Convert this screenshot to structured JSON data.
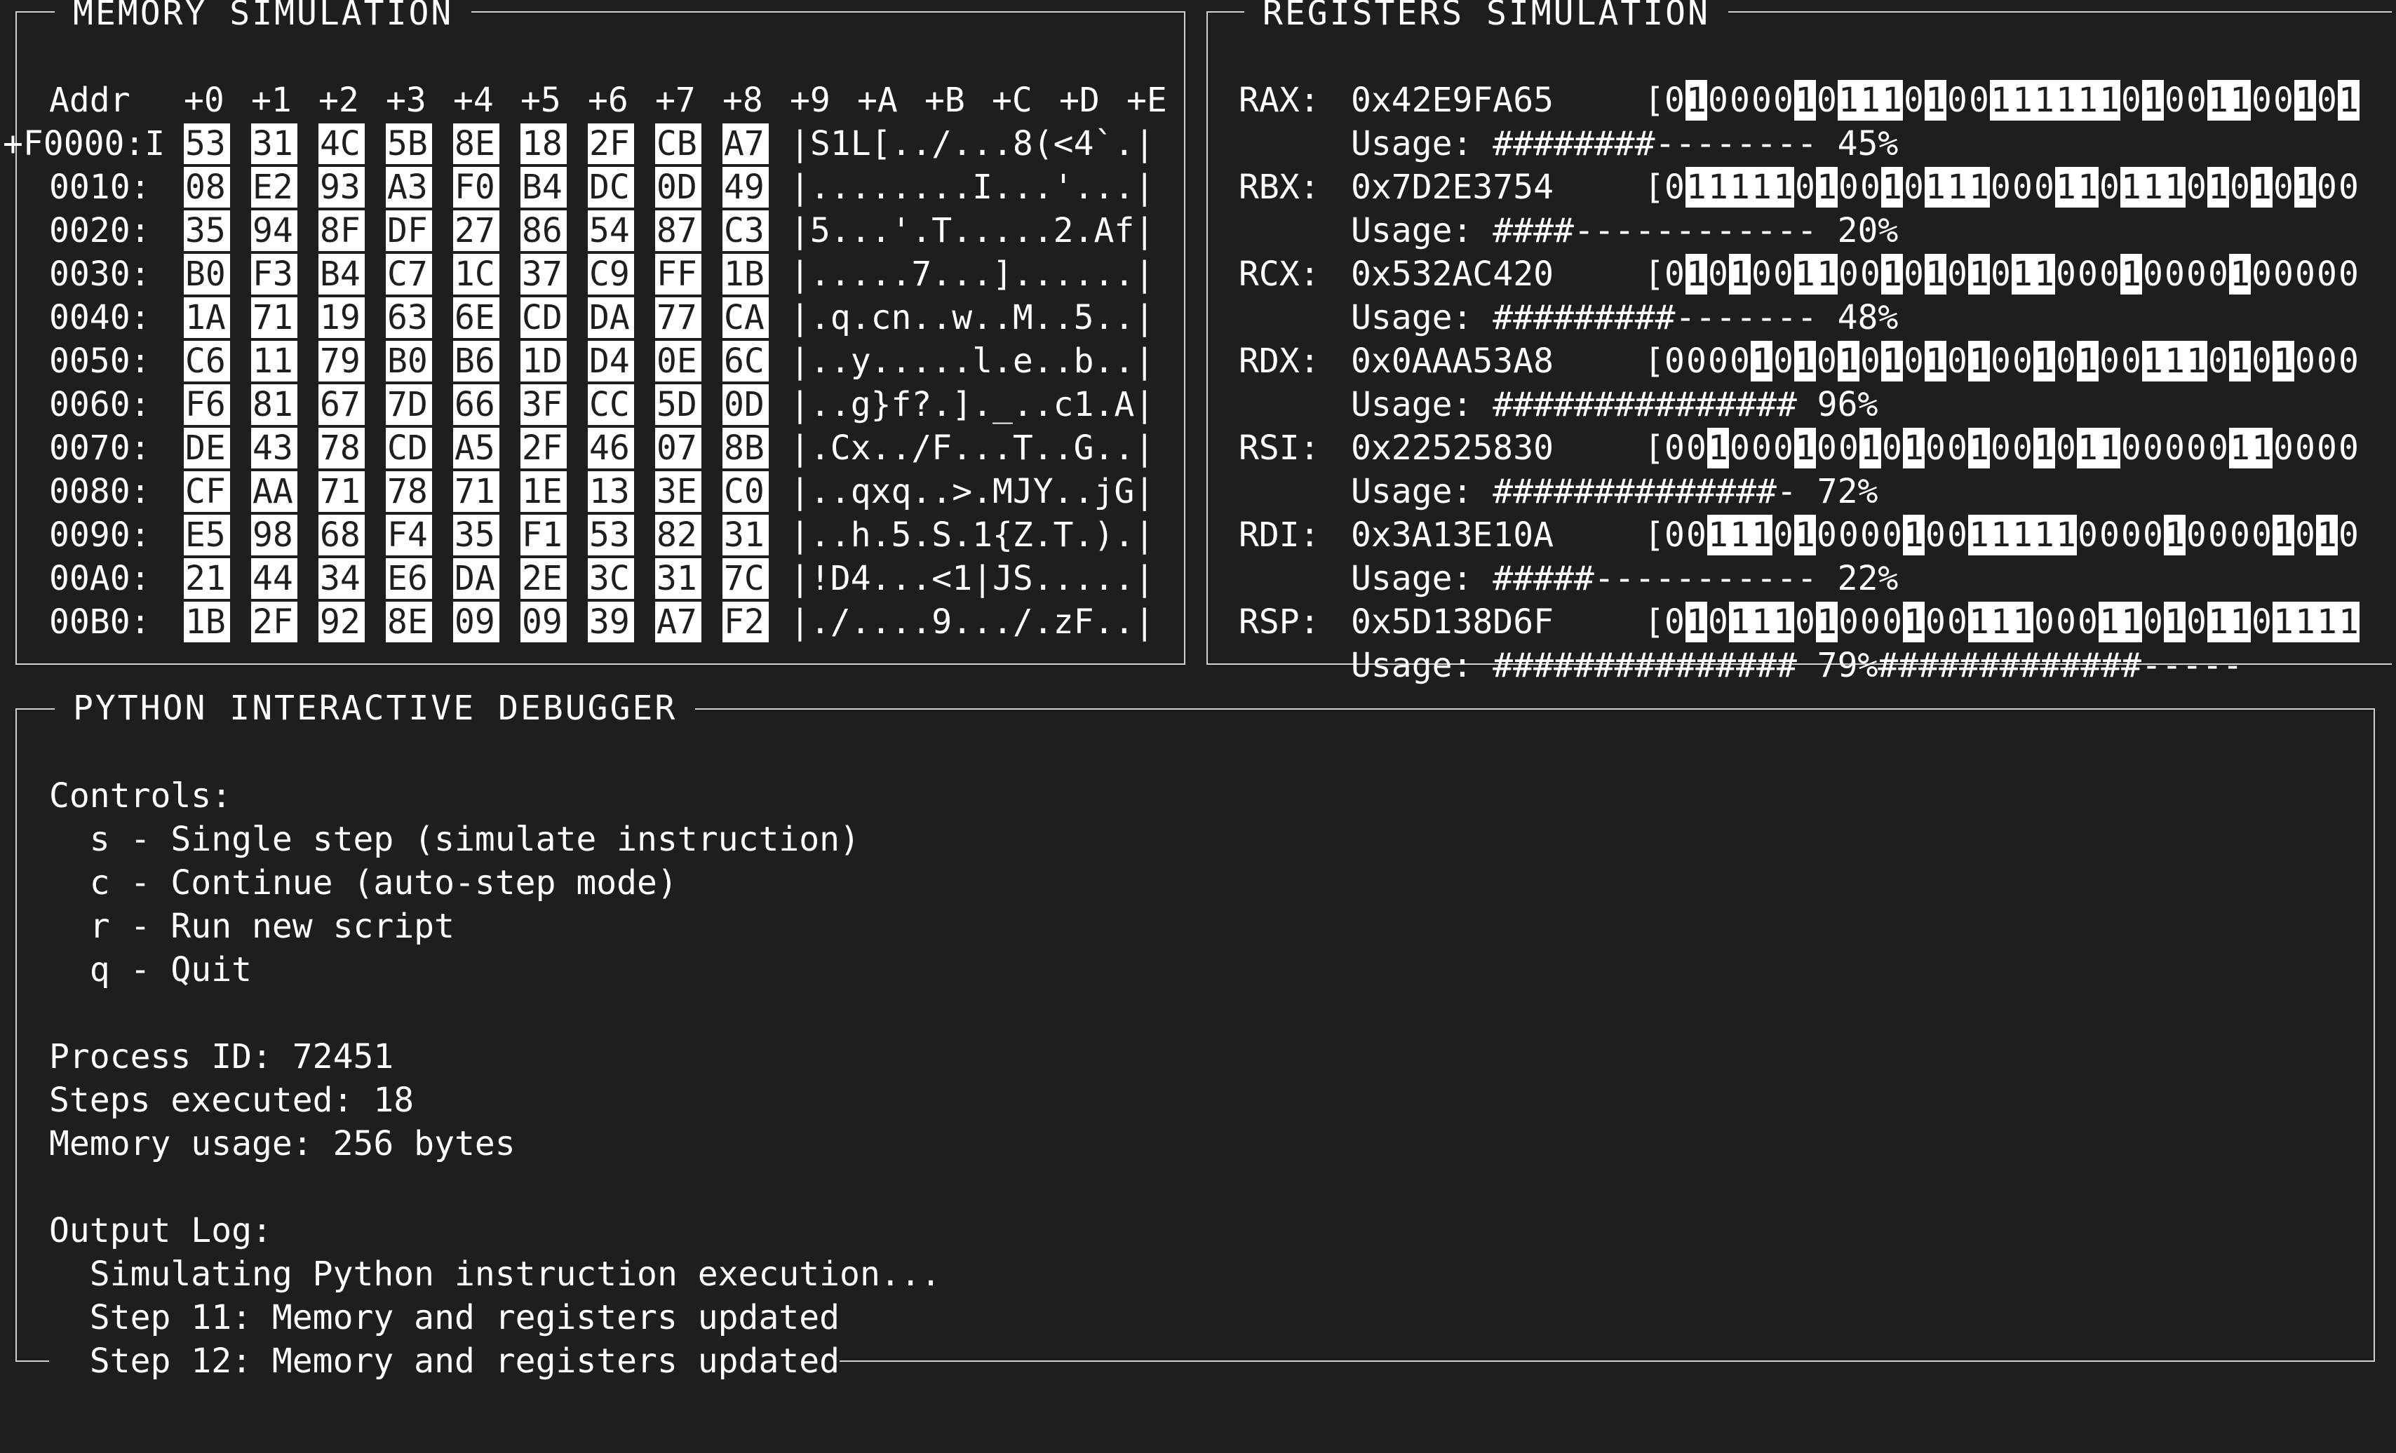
{
  "memory": {
    "title": "MEMORY SIMULATION",
    "header": [
      "Addr",
      "+0",
      "+1",
      "+2",
      "+3",
      "+4",
      "+5",
      "+6",
      "+7",
      "+8",
      "+9",
      "+A",
      "+B",
      "+C",
      "+D",
      "+E"
    ],
    "first_label": "+F0000:I",
    "rows": [
      {
        "addr": "0000:",
        "bytes": [
          "53",
          "31",
          "4C",
          "5B",
          "8E",
          "18",
          "2F",
          "CB",
          "A7"
        ],
        "ascii": "|S1L[../...8(<4`.|"
      },
      {
        "addr": "0010:",
        "bytes": [
          "08",
          "E2",
          "93",
          "A3",
          "F0",
          "B4",
          "DC",
          "0D",
          "49"
        ],
        "ascii": "|........I...'...|"
      },
      {
        "addr": "0020:",
        "bytes": [
          "35",
          "94",
          "8F",
          "DF",
          "27",
          "86",
          "54",
          "87",
          "C3"
        ],
        "ascii": "|5...'.T.....2.Af|"
      },
      {
        "addr": "0030:",
        "bytes": [
          "B0",
          "F3",
          "B4",
          "C7",
          "1C",
          "37",
          "C9",
          "FF",
          "1B"
        ],
        "ascii": "|.....7...]......|"
      },
      {
        "addr": "0040:",
        "bytes": [
          "1A",
          "71",
          "19",
          "63",
          "6E",
          "CD",
          "DA",
          "77",
          "CA"
        ],
        "ascii": "|.q.cn..w..M..5..|"
      },
      {
        "addr": "0050:",
        "bytes": [
          "C6",
          "11",
          "79",
          "B0",
          "B6",
          "1D",
          "D4",
          "0E",
          "6C"
        ],
        "ascii": "|..y.....l.e..b..|"
      },
      {
        "addr": "0060:",
        "bytes": [
          "F6",
          "81",
          "67",
          "7D",
          "66",
          "3F",
          "CC",
          "5D",
          "0D"
        ],
        "ascii": "|..g}f?.]._..c1.A|"
      },
      {
        "addr": "0070:",
        "bytes": [
          "DE",
          "43",
          "78",
          "CD",
          "A5",
          "2F",
          "46",
          "07",
          "8B"
        ],
        "ascii": "|.Cx../F...T..G..|"
      },
      {
        "addr": "0080:",
        "bytes": [
          "CF",
          "AA",
          "71",
          "78",
          "71",
          "1E",
          "13",
          "3E",
          "C0"
        ],
        "ascii": "|..qxq..>.MJY..jG|"
      },
      {
        "addr": "0090:",
        "bytes": [
          "E5",
          "98",
          "68",
          "F4",
          "35",
          "F1",
          "53",
          "82",
          "31"
        ],
        "ascii": "|..h.5.S.1{Z.T.).|"
      },
      {
        "addr": "00A0:",
        "bytes": [
          "21",
          "44",
          "34",
          "E6",
          "DA",
          "2E",
          "3C",
          "31",
          "7C"
        ],
        "ascii": "|!D4...<1|JS.....|"
      },
      {
        "addr": "00B0:",
        "bytes": [
          "1B",
          "2F",
          "92",
          "8E",
          "09",
          "09",
          "39",
          "A7",
          "F2"
        ],
        "ascii": "|./....9.../.zF..|"
      }
    ]
  },
  "registers": {
    "title": "REGISTERS SIMULATION",
    "items": [
      {
        "name": "RAX:",
        "value": "0x42E9FA65",
        "bits": "01000010111010011111101001100101",
        "usage": "Usage: ########-------- 45%",
        "suffix": ""
      },
      {
        "name": "RBX:",
        "value": "0x7D2E3754",
        "bits": "01111101001011100011011101010100",
        "usage": "Usage: ####------------ 20%",
        "suffix": ""
      },
      {
        "name": "RCX:",
        "value": "0x532AC420",
        "bits": "01010011001010101100010000100000",
        "usage": "Usage: #########------- 48%",
        "suffix": ""
      },
      {
        "name": "RDX:",
        "value": "0x0AAA53A8",
        "bits": "00001010101010100101001110101000",
        "usage": "Usage: ############### 96%",
        "suffix": ""
      },
      {
        "name": "RSI:",
        "value": "0x22525830",
        "bits": "00100010010100100101100000110000",
        "usage": "Usage: ##############- 72%",
        "suffix": ""
      },
      {
        "name": "RDI:",
        "value": "0x3A13E10A",
        "bits": "00111010000100111110000100001010",
        "usage": "Usage: #####----------- 22%",
        "suffix": ""
      },
      {
        "name": "RSP:",
        "value": "0x5D138D6F",
        "bits": "01011101000100111000110101101111",
        "usage": "Usage: ############### 79%",
        "suffix": "#############-----"
      }
    ]
  },
  "debugger": {
    "title": "PYTHON INTERACTIVE DEBUGGER",
    "controls_heading": "Controls:",
    "controls": [
      "  s - Single step (simulate instruction)",
      "  c - Continue (auto-step mode)",
      "  r - Run new script",
      "  q - Quit"
    ],
    "process_id": "Process ID: 72451",
    "steps": "Steps executed: 18",
    "memory_usage": "Memory usage: 256 bytes",
    "log_heading": "Output Log:",
    "log": [
      "  Simulating Python instruction execution...",
      "  Step 11: Memory and registers updated",
      "  Step 12: Memory and registers updated"
    ]
  },
  "colors": {
    "background": "#1e1e1e",
    "foreground": "#ffffff",
    "border": "#d0d0d0"
  }
}
